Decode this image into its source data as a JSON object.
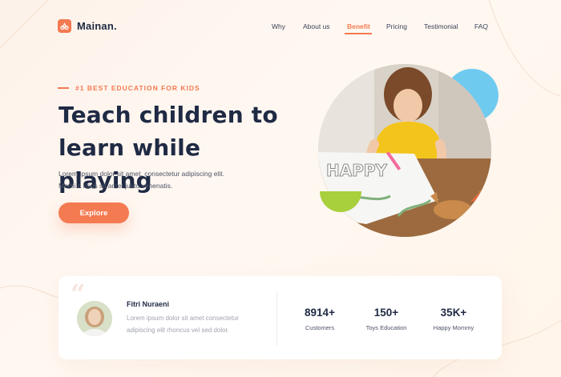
{
  "brand": {
    "name": "Mainan."
  },
  "nav": {
    "items": [
      {
        "label": "Why"
      },
      {
        "label": "About us"
      },
      {
        "label": "Benefit",
        "active": true
      },
      {
        "label": "Pricing"
      },
      {
        "label": "Testimonial"
      },
      {
        "label": "FAQ"
      }
    ]
  },
  "hero": {
    "eyebrow": "#1 BEST EDUCATION FOR KIDS",
    "headline_line1": "Teach children to",
    "headline_line2": "learn while playing",
    "desc_line1": "Lorem ipsum dolor sit amet, consectetur adipiscing elit.",
    "desc_line2": "Morbi a risus sit amet justo venenatis.",
    "cta_label": "Explore"
  },
  "testimonial": {
    "name": "Fitri Nuraeni",
    "text_line1": "Lorem ipsum dolor sit amet consectetur",
    "text_line2": "adipiscing elit rhoncus vel sed dolor."
  },
  "stats": [
    {
      "value": "8914+",
      "label": "Customers"
    },
    {
      "value": "150+",
      "label": "Toys Education"
    },
    {
      "value": "35K+",
      "label": "Happy Mommy"
    }
  ],
  "colors": {
    "accent": "#f47a51",
    "navy": "#1f2a44",
    "blue": "#6fcaf0",
    "green": "#a8cf3c"
  }
}
